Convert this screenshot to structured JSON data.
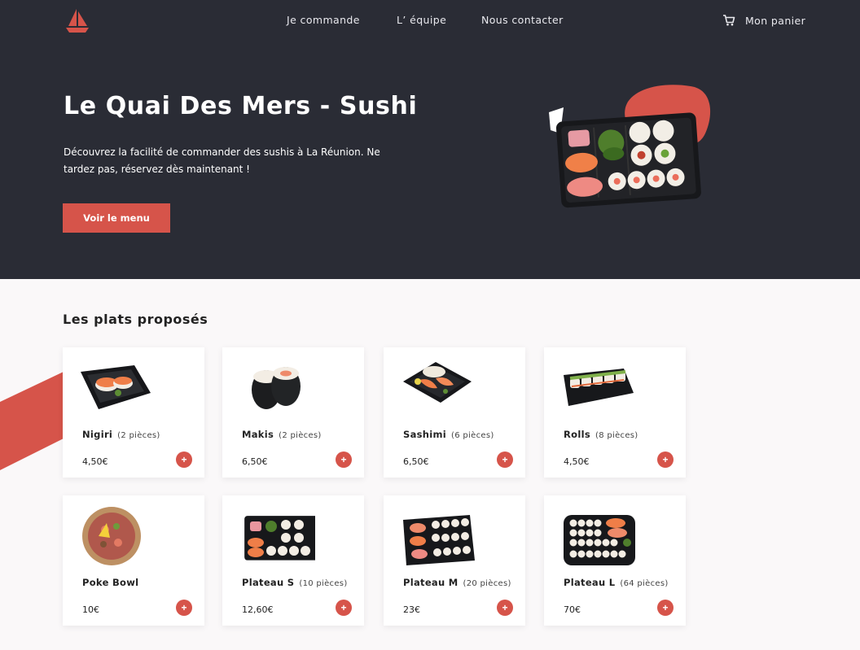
{
  "nav": {
    "links": [
      {
        "label": "Je commande"
      },
      {
        "label": "L’ équipe"
      },
      {
        "label": "Nous contacter"
      }
    ],
    "cart_label": "Mon panier"
  },
  "hero": {
    "title": "Le Quai Des Mers - Sushi",
    "subtitle": "Découvrez la facilité de commander des sushis à La Réunion. Ne tardez pas, réservez dès maintenant !",
    "button": "Voir le menu"
  },
  "section": {
    "title": "Les plats proposés"
  },
  "dishes": [
    {
      "name": "Nigiri",
      "pieces": "(2 pièces)",
      "price": "4,50€",
      "add": "+"
    },
    {
      "name": "Makis",
      "pieces": "(2 pièces)",
      "price": "6,50€",
      "add": "+"
    },
    {
      "name": "Sashimi",
      "pieces": "(6 pièces)",
      "price": "6,50€",
      "add": "+"
    },
    {
      "name": "Rolls",
      "pieces": "(8 pièces)",
      "price": "4,50€",
      "add": "+"
    },
    {
      "name": "Poke Bowl",
      "pieces": "",
      "price": "10€",
      "add": "+"
    },
    {
      "name": "Plateau S",
      "pieces": "(10 pièces)",
      "price": "12,60€",
      "add": "+"
    },
    {
      "name": "Plateau M",
      "pieces": "(20 pièces)",
      "price": "23€",
      "add": "+"
    },
    {
      "name": "Plateau L",
      "pieces": "(64 pièces)",
      "price": "70€",
      "add": "+"
    }
  ],
  "colors": {
    "dark": "#2a2c35",
    "accent": "#d6544a",
    "background": "#faf8f9"
  },
  "icons": {
    "logo": "sailboat-logo-icon",
    "cart": "shopping-cart-icon",
    "add": "plus-icon"
  }
}
